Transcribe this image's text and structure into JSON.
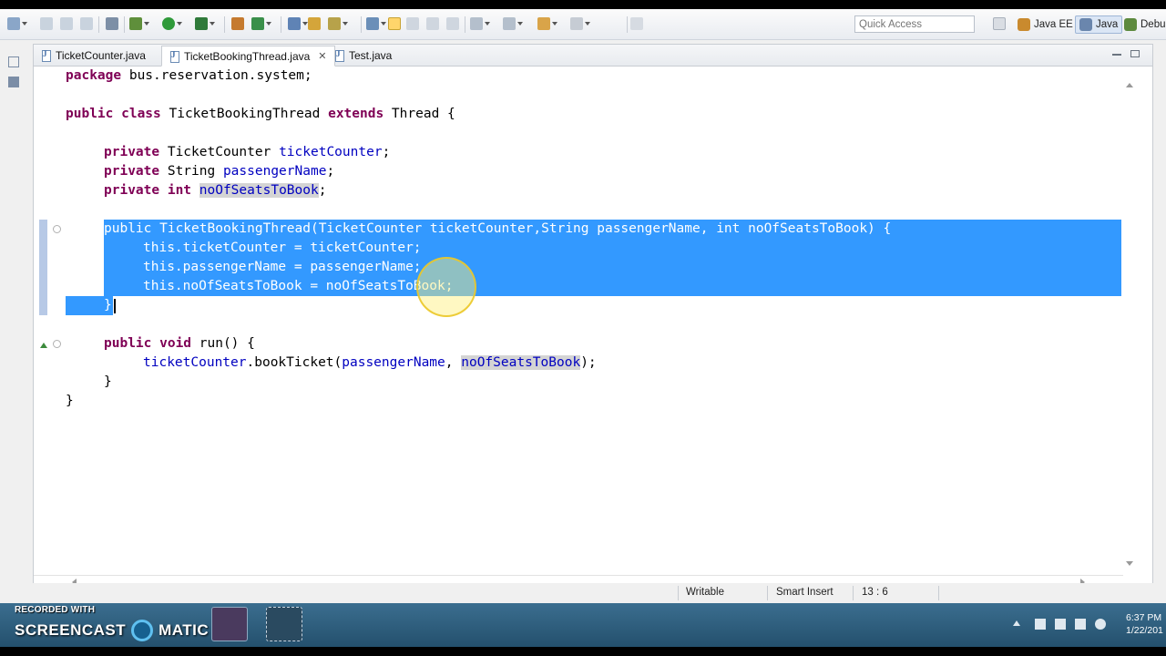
{
  "toolbar": {
    "quick_access_placeholder": "Quick Access",
    "perspectives": [
      {
        "label": "Java EE",
        "icon": "java-ee-perspective-icon"
      },
      {
        "label": "Java",
        "icon": "java-perspective-icon",
        "active": true
      },
      {
        "label": "Debu",
        "icon": "debug-perspective-icon"
      }
    ]
  },
  "tabs": [
    {
      "label": "TicketCounter.java",
      "active": false
    },
    {
      "label": "TicketBookingThread.java",
      "active": true,
      "close": "✕"
    },
    {
      "label": "Test.java",
      "active": false
    }
  ],
  "code": {
    "line1": {
      "kw": "package",
      "rest": " bus.reservation.system;"
    },
    "line3": {
      "kw1": "public class",
      "name": " TicketBookingThread ",
      "kw2": "extends",
      "rest": " Thread {"
    },
    "line5": {
      "kw": "private",
      "type": " TicketCounter ",
      "field": "ticketCounter",
      "end": ";"
    },
    "line6": {
      "kw": "private",
      "type": " String ",
      "field": "passengerName",
      "end": ";"
    },
    "line7": {
      "kw": "private int",
      "field": "noOfSeatsToBook",
      "end": ";"
    },
    "line9": "public TicketBookingThread(TicketCounter ticketCounter,String passengerName, int noOfSeatsToBook) {",
    "line10": "this.ticketCounter = ticketCounter;",
    "line11": "this.passengerName = passengerName;",
    "line12": "this.noOfSeatsToBook = noOfSeatsToBook;",
    "line13": "}",
    "line15": {
      "kw": "public void",
      "rest": " run() {"
    },
    "line16": {
      "field1": "ticketCounter",
      "call": ".bookTicket(",
      "arg1": "passengerName",
      "sep": ", ",
      "arg2": "noOfSeatsToBook",
      "end": ");"
    },
    "line17": "}",
    "line18": "}"
  },
  "status": {
    "writable": "Writable",
    "insert_mode": "Smart Insert",
    "position": "13 : 6"
  },
  "taskbar": {
    "watermark_top": "RECORDED WITH",
    "watermark_left": "SCREENCAST",
    "watermark_right": "MATIC",
    "clock_time": "6:37 PM",
    "clock_date": "1/22/201"
  },
  "colors": {
    "selection": "#3399ff",
    "keyword": "#7f0055",
    "field": "#0000c0",
    "taskbar": "#2c5d7d"
  }
}
